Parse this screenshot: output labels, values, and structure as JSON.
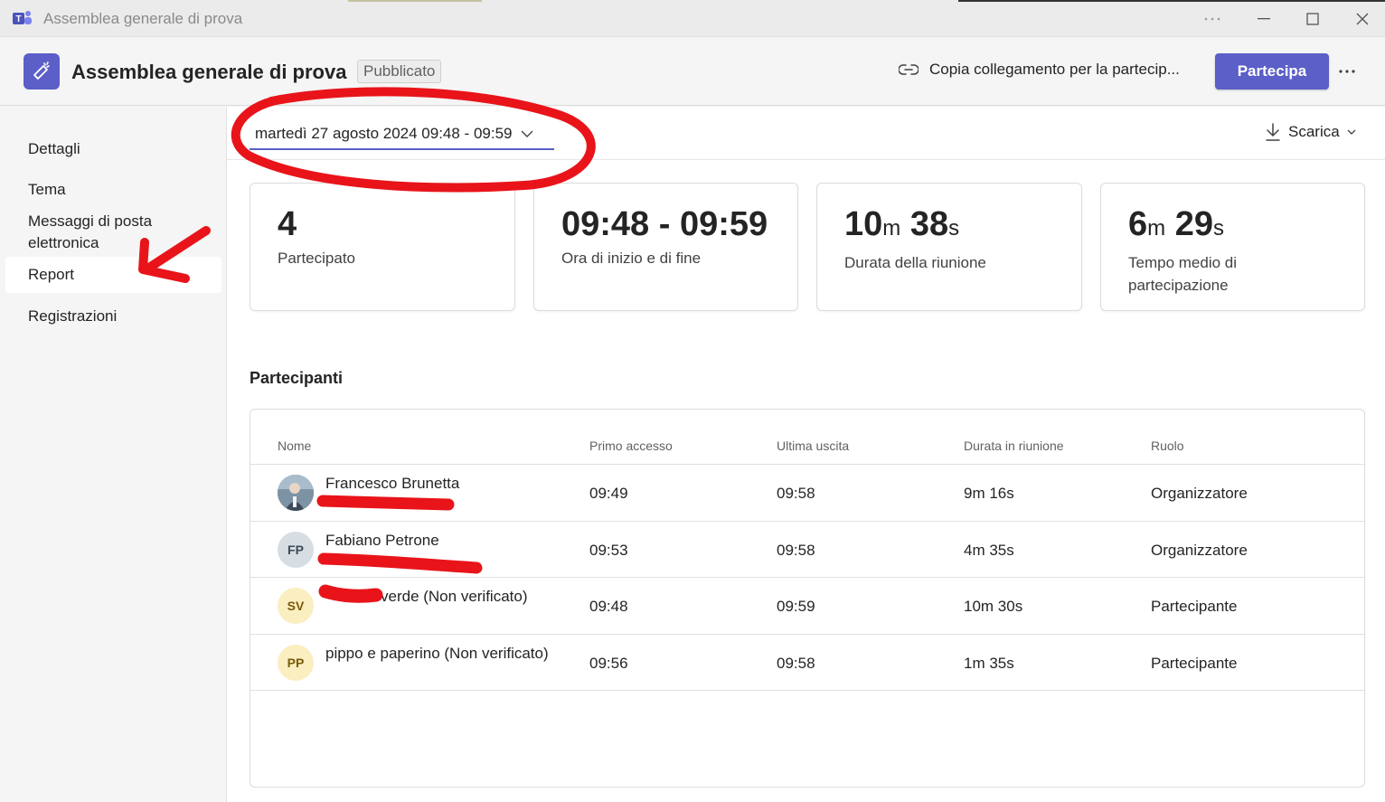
{
  "window": {
    "title": "Assemblea generale di prova"
  },
  "header": {
    "title": "Assemblea generale di prova",
    "status": "Pubblicato",
    "copy_link": "Copia collegamento per la partecip...",
    "join": "Partecipa"
  },
  "sidebar": {
    "items": [
      {
        "label": "Dettagli"
      },
      {
        "label": "Tema"
      },
      {
        "label": "Messaggi di posta elettronica"
      },
      {
        "label": "Report",
        "active": true
      },
      {
        "label": "Registrazioni"
      }
    ]
  },
  "toolbar": {
    "date_range": "martedì 27 agosto 2024 09:48 - 09:59",
    "download": "Scarica"
  },
  "stats": [
    {
      "value": "4",
      "label": "Partecipato"
    },
    {
      "value": "09:48 - 09:59",
      "label": "Ora di inizio e di fine"
    },
    {
      "value_parts": [
        "10",
        "m",
        " 38",
        "s"
      ],
      "label": "Durata della riunione"
    },
    {
      "value_parts": [
        "6",
        "m",
        " 29",
        "s"
      ],
      "label": "Tempo medio di partecipazione"
    }
  ],
  "participants": {
    "title": "Partecipanti",
    "columns": [
      "Nome",
      "Primo accesso",
      "Ultima uscita",
      "Durata in riunione",
      "Ruolo"
    ],
    "rows": [
      {
        "initials": "",
        "name": "Francesco Brunetta",
        "first": "09:49",
        "last": "09:58",
        "duration": "9m 16s",
        "role": "Organizzatore"
      },
      {
        "initials": "FP",
        "name": "Fabiano Petrone",
        "first": "09:53",
        "last": "09:58",
        "duration": "4m 35s",
        "role": "Organizzatore"
      },
      {
        "initials": "SV",
        "name": "verde (Non verificato)",
        "first": "09:48",
        "last": "09:59",
        "duration": "10m 30s",
        "role": "Partecipante"
      },
      {
        "initials": "PP",
        "name": "pippo e paperino (Non verificato)",
        "first": "09:56",
        "last": "09:58",
        "duration": "1m 35s",
        "role": "Partecipante"
      }
    ]
  },
  "colors": {
    "accent": "#5b5fc7",
    "annotation": "#e8141a",
    "avatar_fp_bg": "#d6dde3",
    "avatar_yellow_bg": "#fbeec0"
  }
}
